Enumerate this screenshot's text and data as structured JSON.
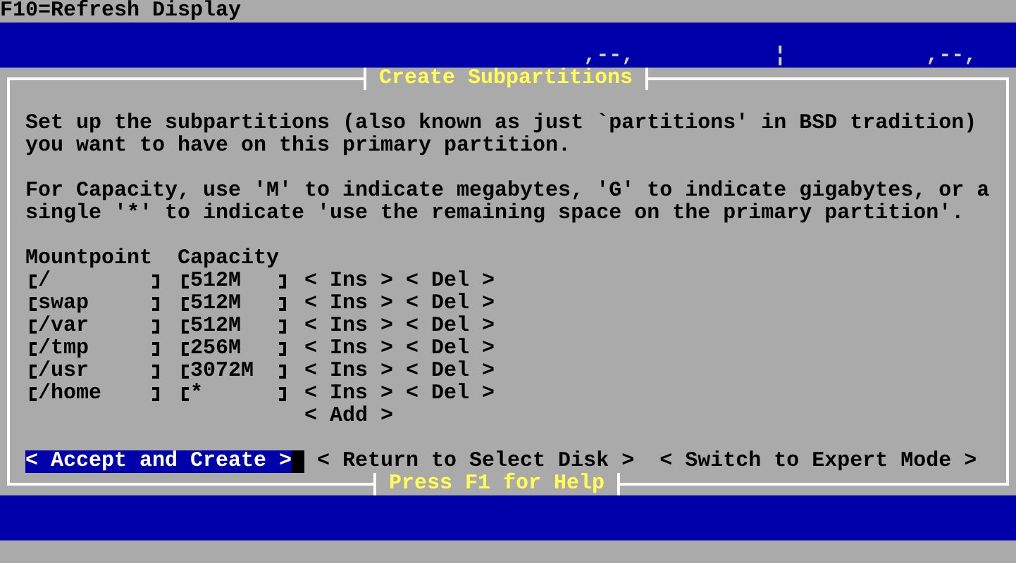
{
  "help_line": "F10=Refresh Display",
  "banner_art": [
    ",--,",
    "¦",
    ",--,"
  ],
  "dialog": {
    "title": "Create Subpartitions",
    "paragraphs": [
      [
        "Set up the subpartitions (also known as just `partitions' in BSD tradition)",
        "you want to have on this primary partition."
      ],
      [
        "For Capacity, use 'M' to indicate megabytes, 'G' to indicate gigabytes, or a",
        "single '*' to indicate 'use the remaining space on the primary partition'."
      ]
    ],
    "columns": [
      "Mountpoint",
      "Capacity"
    ],
    "rows": [
      {
        "mountpoint": "/",
        "capacity": "512M",
        "insert": "< Ins >",
        "delete": "< Del >"
      },
      {
        "mountpoint": "swap",
        "capacity": "512M",
        "insert": "< Ins >",
        "delete": "< Del >"
      },
      {
        "mountpoint": "/var",
        "capacity": "512M",
        "insert": "< Ins >",
        "delete": "< Del >"
      },
      {
        "mountpoint": "/tmp",
        "capacity": "256M",
        "insert": "< Ins >",
        "delete": "< Del >"
      },
      {
        "mountpoint": "/usr",
        "capacity": "3072M",
        "insert": "< Ins >",
        "delete": "< Del >"
      },
      {
        "mountpoint": "/home",
        "capacity": "*",
        "insert": "< Ins >",
        "delete": "< Del >"
      }
    ],
    "add_button": "< Add >",
    "buttons": [
      {
        "label": "< Accept and Create >",
        "selected": true
      },
      {
        "label": "< Return to Select Disk >",
        "selected": false
      },
      {
        "label": "< Switch to Expert Mode >",
        "selected": false
      }
    ],
    "footer": "Press F1 for Help"
  }
}
